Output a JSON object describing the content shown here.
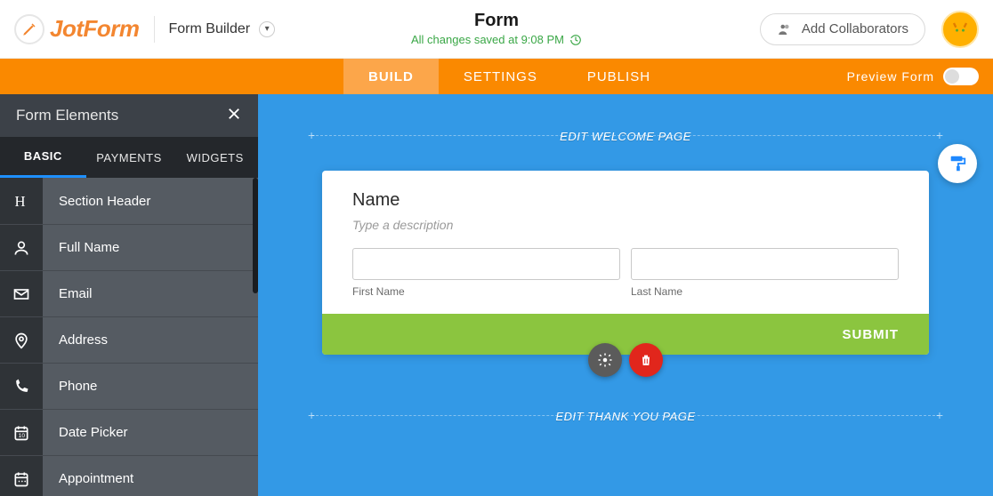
{
  "header": {
    "brand": "JotForm",
    "breadcrumb": "Form Builder",
    "form_title": "Form",
    "save_status": "All changes saved at 9:08 PM",
    "collab_label": "Add Collaborators"
  },
  "tabs": {
    "build": "BUILD",
    "settings": "SETTINGS",
    "publish": "PUBLISH",
    "preview_label": "Preview Form"
  },
  "sidebar": {
    "title": "Form Elements",
    "tabs": {
      "basic": "BASIC",
      "payments": "PAYMENTS",
      "widgets": "WIDGETS"
    },
    "items": [
      {
        "label": "Section Header",
        "icon": "heading-icon"
      },
      {
        "label": "Full Name",
        "icon": "user-icon"
      },
      {
        "label": "Email",
        "icon": "email-icon"
      },
      {
        "label": "Address",
        "icon": "location-icon"
      },
      {
        "label": "Phone",
        "icon": "phone-icon"
      },
      {
        "label": "Date Picker",
        "icon": "date-icon"
      },
      {
        "label": "Appointment",
        "icon": "calendar-icon"
      }
    ]
  },
  "canvas": {
    "welcome_hint": "EDIT WELCOME PAGE",
    "thank_hint": "EDIT THANK YOU PAGE",
    "field_title": "Name",
    "field_desc": "Type a description",
    "first_label": "First Name",
    "last_label": "Last Name",
    "submit": "SUBMIT"
  }
}
